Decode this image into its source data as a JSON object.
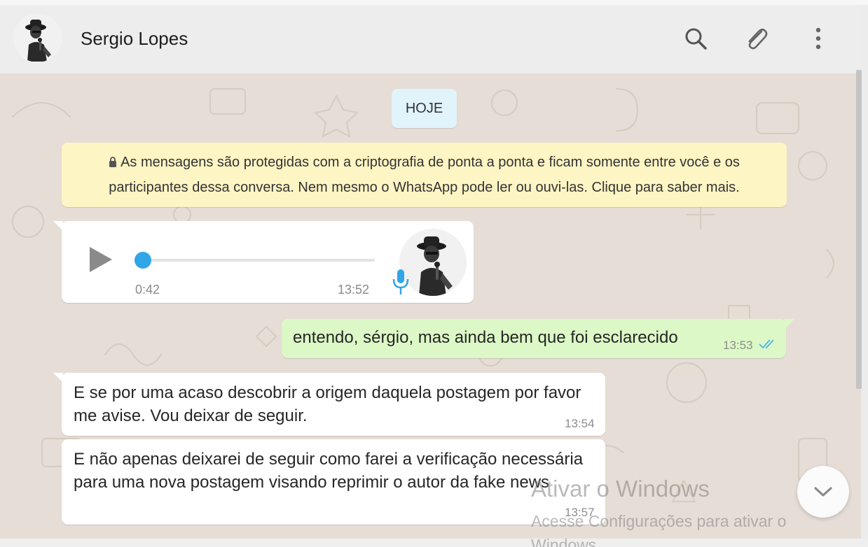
{
  "header": {
    "contact_name": "Sergio Lopes",
    "icons": [
      "search-icon",
      "paperclip-icon",
      "more-vertical-icon"
    ]
  },
  "chat": {
    "date_label": "HOJE",
    "encryption_notice": "As mensagens são protegidas com a criptografia de ponta a ponta e ficam somente entre você e os participantes dessa conversa. Nem mesmo o WhatsApp pode ler ou ouvi-las. Clique para saber mais.",
    "voice_message": {
      "duration": "0:42",
      "time": "13:52",
      "progress": 0
    },
    "messages": [
      {
        "direction": "outgoing",
        "text": "entendo, sérgio, mas ainda bem que foi esclarecido",
        "time": "13:53",
        "status": "read"
      },
      {
        "direction": "incoming",
        "text": "E se por uma acaso descobrir a origem daquela postagem por favor me avise. Vou deixar de seguir.",
        "time": "13:54"
      },
      {
        "direction": "incoming",
        "text": "E não apenas deixarei de seguir como farei a verificação necessária para uma nova postagem visando reprimir o autor da fake news",
        "time": "13:57"
      }
    ]
  },
  "overlay": {
    "watermark_title": "Ativar o Windows",
    "watermark_subtitle": "Acesse Configurações para ativar o Windows."
  },
  "colors": {
    "header_bg": "#ededed",
    "chat_bg": "#e6ded6",
    "outgoing_bubble": "#dcf8c6",
    "incoming_bubble": "#ffffff",
    "notice_bg": "#fdf5c4",
    "date_pill_bg": "#e1f3fb",
    "accent_blue": "#30a6e6"
  }
}
